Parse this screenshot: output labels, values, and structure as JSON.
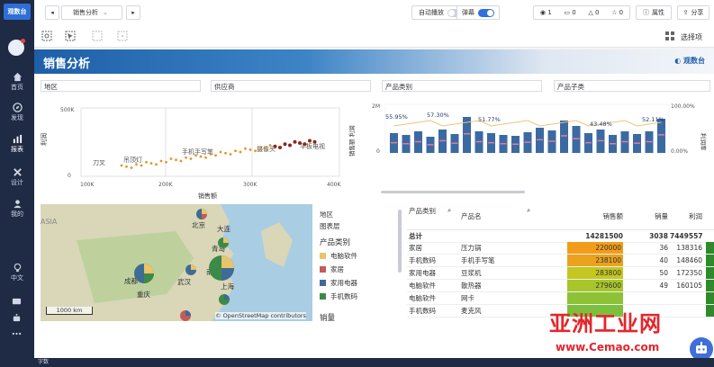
{
  "app": {
    "logo_text": "观数台"
  },
  "sidebar": {
    "items": [
      {
        "label": "首页",
        "icon": "home-icon"
      },
      {
        "label": "发现",
        "icon": "compass-icon"
      },
      {
        "label": "报表",
        "icon": "chart-icon"
      },
      {
        "label": "设计",
        "icon": "tools-icon"
      },
      {
        "label": "我的",
        "icon": "user-icon"
      },
      {
        "label": "中文",
        "icon": "help-icon"
      }
    ]
  },
  "topbar": {
    "tab_title": "销售分析",
    "autoplay_label": "自动播放",
    "danmu_label": "弹幕",
    "counts": {
      "views": "1",
      "comments": "0",
      "likes": "0",
      "stars": "0"
    },
    "props_label": "属性",
    "share_label": "分享"
  },
  "toolbar": {
    "options_label": "选择项"
  },
  "report": {
    "title": "销售分析",
    "brand": "观数台",
    "filters": [
      "地区",
      "供应商",
      "产品类别",
      "产品子类"
    ]
  },
  "scatter": {
    "ylabel": "利润",
    "xlabel": "销售额",
    "yticks": [
      "500K",
      "0"
    ],
    "xticks": [
      "100K",
      "200K",
      "300K",
      "400K"
    ],
    "labels": [
      "刀叉",
      "吊顶灯",
      "手机手写笔",
      "摄像头",
      "平板电视"
    ]
  },
  "combo": {
    "y_left_label": "销售额 利润",
    "y_right_label": "利润率",
    "y_left_ticks": [
      "2M",
      "0"
    ],
    "y_right_ticks": [
      "100.00%",
      "0.00%"
    ],
    "pct_labels": [
      "55.95%",
      "57.30%",
      "51.77%",
      "43.48%",
      "52.11%"
    ]
  },
  "map": {
    "cities": [
      "北京",
      "大连",
      "青岛",
      "成都",
      "武汉",
      "南京",
      "上海",
      "重庆"
    ],
    "scale": "1000 km",
    "attribution": "© OpenStreetMap contributors"
  },
  "legend": {
    "title1": "地区",
    "title2": "图表层",
    "title3": "产品类别",
    "title4": "销量",
    "items": [
      {
        "label": "电脑软件",
        "color": "#e8c46a"
      },
      {
        "label": "家居",
        "color": "#c45b5b"
      },
      {
        "label": "家用电器",
        "color": "#3f6b94"
      },
      {
        "label": "手机数码",
        "color": "#3c8a4a"
      }
    ]
  },
  "table": {
    "headers": [
      "产品类别",
      "产品名",
      "销售额",
      "销量",
      "利润"
    ],
    "total": {
      "label": "总计",
      "sales": "14281500",
      "qty": "3038",
      "profit": "7449557"
    },
    "rows": [
      {
        "cat": "家居",
        "name": "压力锅",
        "sales": "220000",
        "qty": "36",
        "profit": "138316",
        "color": "#f29d1a"
      },
      {
        "cat": "手机数码",
        "name": "手机手写笔",
        "sales": "238100",
        "qty": "40",
        "profit": "148460",
        "color": "#eaa21f"
      },
      {
        "cat": "家用电器",
        "name": "豆浆机",
        "sales": "283800",
        "qty": "50",
        "profit": "172350",
        "color": "#c4c71f"
      },
      {
        "cat": "电脑软件",
        "name": "散热器",
        "sales": "279600",
        "qty": "49",
        "profit": "160105",
        "color": "#a8c52a"
      },
      {
        "cat": "电脑软件",
        "name": "网卡",
        "sales": "",
        "qty": "",
        "profit": "",
        "color": "#8dc236"
      },
      {
        "cat": "手机数码",
        "name": "麦克风",
        "sales": "",
        "qty": "",
        "profit": "",
        "color": "#7dbf3c"
      }
    ]
  },
  "watermark": {
    "line1": "亚洲工业网",
    "line2": "www.Cemao.com"
  },
  "statusbar": {
    "text": "字数"
  }
}
